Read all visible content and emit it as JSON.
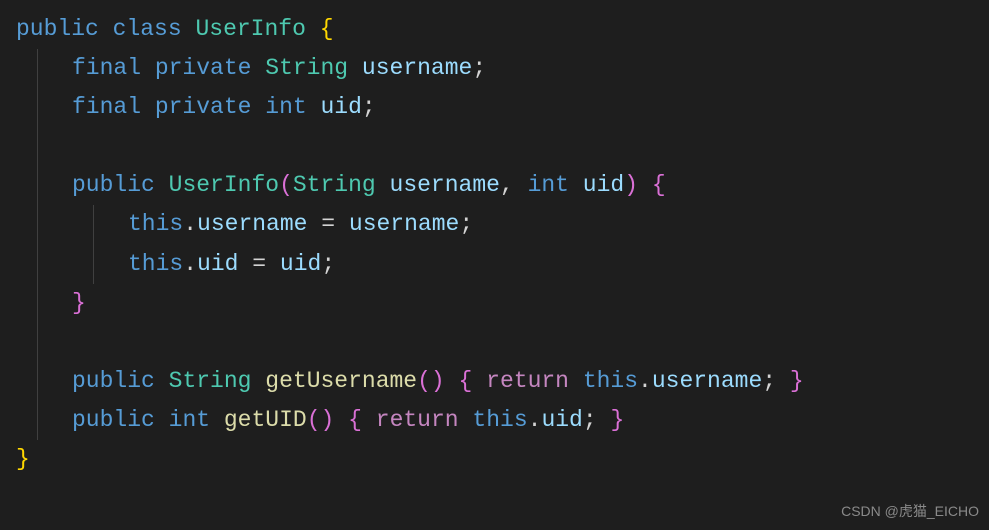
{
  "code": {
    "l1": {
      "public": "public",
      "class": "class",
      "UserInfo": "UserInfo",
      "lb": "{"
    },
    "l2": {
      "final": "final",
      "private": "private",
      "String": "String",
      "username": "username",
      "semi": ";"
    },
    "l3": {
      "final": "final",
      "private": "private",
      "int": "int",
      "uid": "uid",
      "semi": ";"
    },
    "l5": {
      "public": "public",
      "UserInfo": "UserInfo",
      "lp": "(",
      "String": "String",
      "username": "username",
      "comma": ",",
      "int": "int",
      "uid": "uid",
      "rp": ")",
      "lb": "{"
    },
    "l6": {
      "this": "this",
      "dot": ".",
      "username1": "username",
      "eq": "=",
      "username2": "username",
      "semi": ";"
    },
    "l7": {
      "this": "this",
      "dot": ".",
      "uid1": "uid",
      "eq": "=",
      "uid2": "uid",
      "semi": ";"
    },
    "l8": {
      "rb": "}"
    },
    "l10": {
      "public": "public",
      "String": "String",
      "getUsername": "getUsername",
      "lp": "(",
      "rp": ")",
      "lb": "{",
      "return": "return",
      "this": "this",
      "dot": ".",
      "username": "username",
      "semi": ";",
      "rb": "}"
    },
    "l11": {
      "public": "public",
      "int": "int",
      "getUID": "getUID",
      "lp": "(",
      "rp": ")",
      "lb": "{",
      "return": "return",
      "this": "this",
      "dot": ".",
      "uid": "uid",
      "semi": ";",
      "rb": "}"
    },
    "l12": {
      "rb": "}"
    }
  },
  "watermark": "CSDN @虎猫_EICHO"
}
